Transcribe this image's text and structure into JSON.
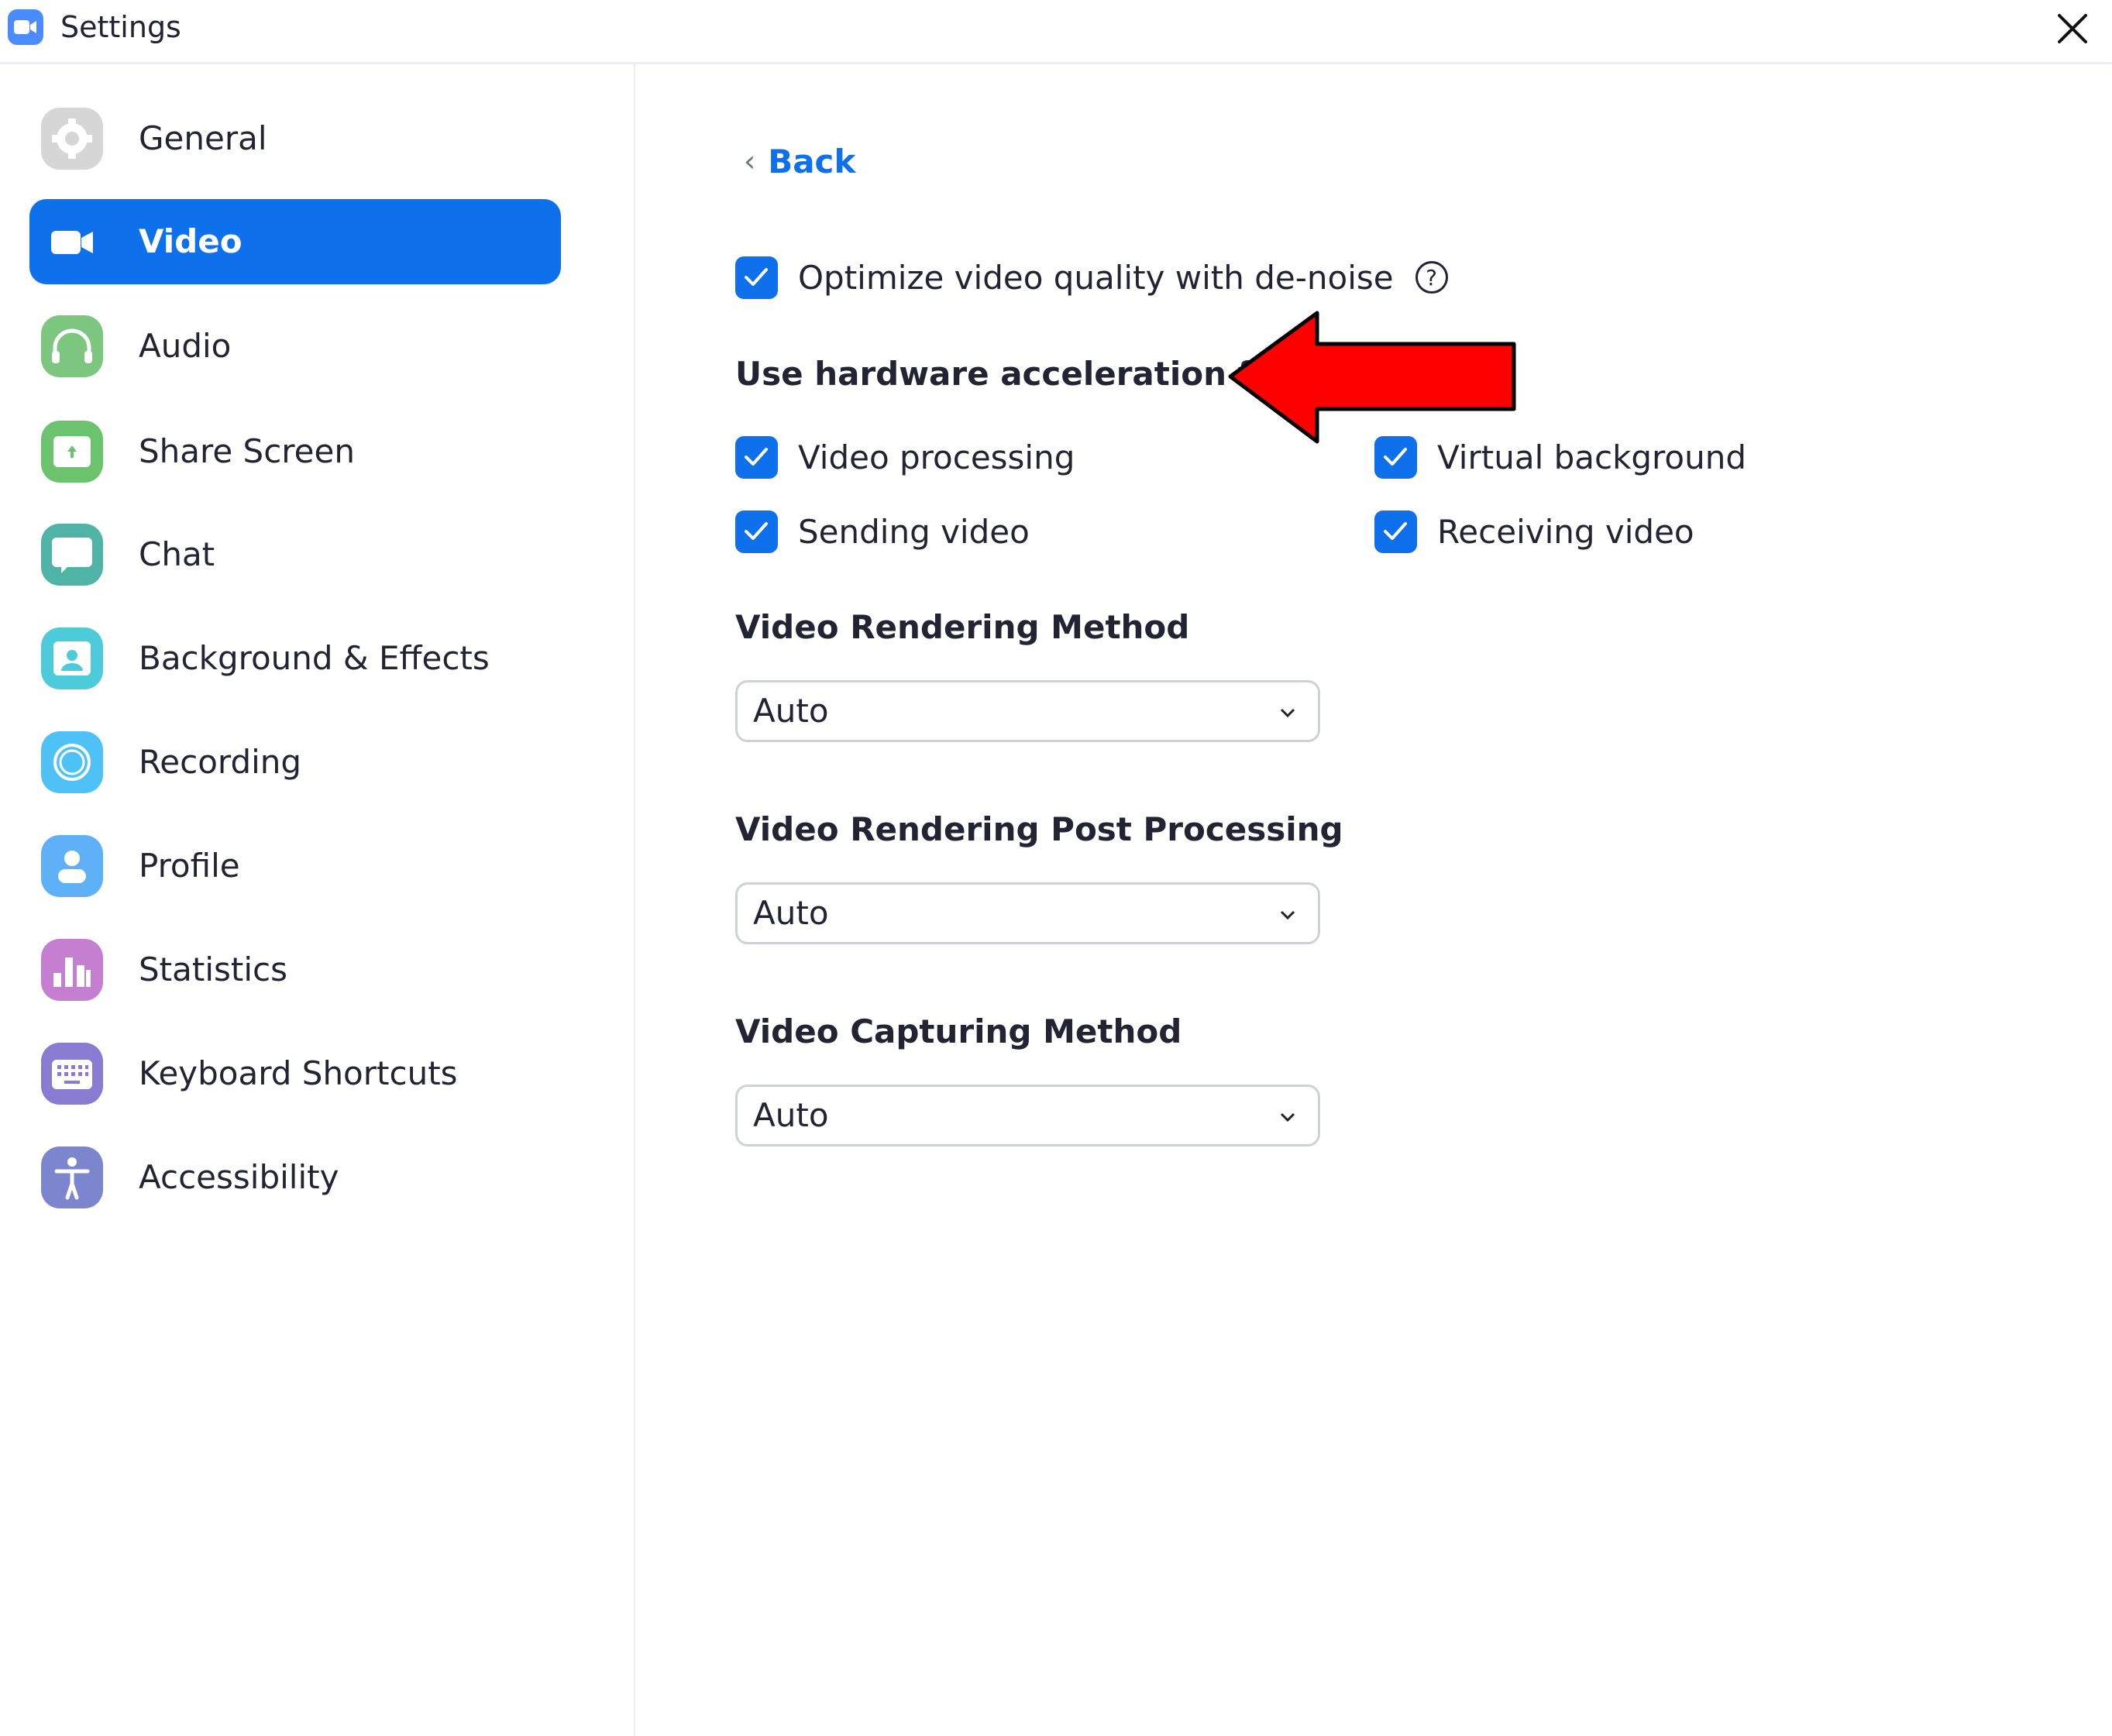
{
  "window": {
    "title": "Settings",
    "app_icon": "zoom-video-camera-icon",
    "close_icon": "close-icon"
  },
  "sidebar": {
    "items": [
      {
        "label": "General",
        "icon": "gear-icon",
        "color": "#d6d6d6",
        "active": false
      },
      {
        "label": "Video",
        "icon": "video-camera-icon",
        "color": "#0e71eb",
        "active": true
      },
      {
        "label": "Audio",
        "icon": "headphones-icon",
        "color": "#7dc67f",
        "active": false
      },
      {
        "label": "Share Screen",
        "icon": "share-screen-icon",
        "color": "#6cc36e",
        "active": false
      },
      {
        "label": "Chat",
        "icon": "chat-bubble-icon",
        "color": "#4fb3a5",
        "active": false
      },
      {
        "label": "Background & Effects",
        "icon": "background-person-icon",
        "color": "#4ecbdb",
        "active": false
      },
      {
        "label": "Recording",
        "icon": "record-circle-icon",
        "color": "#4ec1f7",
        "active": false
      },
      {
        "label": "Profile",
        "icon": "profile-person-icon",
        "color": "#5eb1f7",
        "active": false
      },
      {
        "label": "Statistics",
        "icon": "bar-chart-icon",
        "color": "#c57fd1",
        "active": false
      },
      {
        "label": "Keyboard Shortcuts",
        "icon": "keyboard-icon",
        "color": "#8a7bd2",
        "active": false
      },
      {
        "label": "Accessibility",
        "icon": "accessibility-icon",
        "color": "#7b86cf",
        "active": false
      }
    ]
  },
  "main": {
    "back_label": "Back",
    "denoise": {
      "label": "Optimize video quality with de-noise",
      "checked": true,
      "help_glyph": "?"
    },
    "hw_accel": {
      "heading": "Use hardware acceleration for",
      "options": [
        {
          "label": "Video processing",
          "checked": true
        },
        {
          "label": "Virtual background",
          "checked": true
        },
        {
          "label": "Sending video",
          "checked": true
        },
        {
          "label": "Receiving video",
          "checked": true
        }
      ]
    },
    "rendering_method": {
      "heading": "Video Rendering Method",
      "value": "Auto"
    },
    "post_processing": {
      "heading": "Video Rendering Post Processing",
      "value": "Auto"
    },
    "capturing_method": {
      "heading": "Video Capturing Method",
      "value": "Auto"
    }
  },
  "annotation": {
    "type": "red-arrow",
    "color": "#ff0000",
    "points_to": "Use hardware acceleration for"
  },
  "colors": {
    "accent": "#0e71eb",
    "text": "#232333",
    "divider": "#eceef3"
  }
}
